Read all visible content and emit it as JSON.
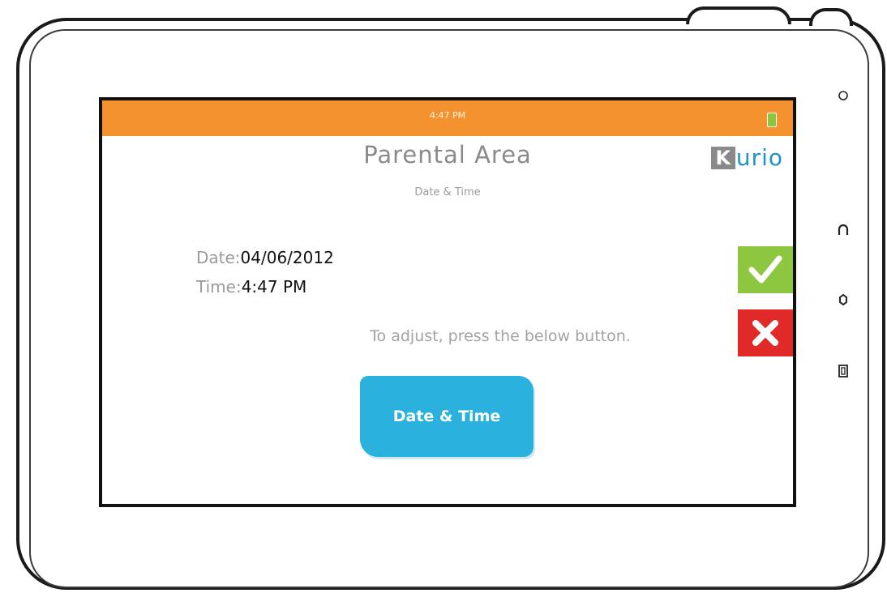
{
  "device": {
    "hardware_icons": [
      "circle-icon",
      "headset-icon",
      "speaker-icon",
      "battery-door-icon"
    ]
  },
  "statusbar": {
    "time": "4:47 PM",
    "battery_icon": "battery-icon",
    "color": "#f3922f"
  },
  "header": {
    "title": "Parental Area",
    "subtitle": "Date & Time",
    "logo_letter": "K",
    "logo_rest": "urio"
  },
  "info": {
    "date_label": "Date:",
    "date_value": "04/06/2012",
    "time_label": "Time:",
    "time_value": "4:47 PM"
  },
  "hint": "To adjust, press the below button.",
  "buttons": {
    "date_time_label": "Date & Time",
    "confirm_icon": "checkmark-icon",
    "cancel_icon": "close-icon",
    "confirm_color": "#8dc63f",
    "cancel_color": "#e12a27",
    "date_time_color": "#2bb1de"
  }
}
